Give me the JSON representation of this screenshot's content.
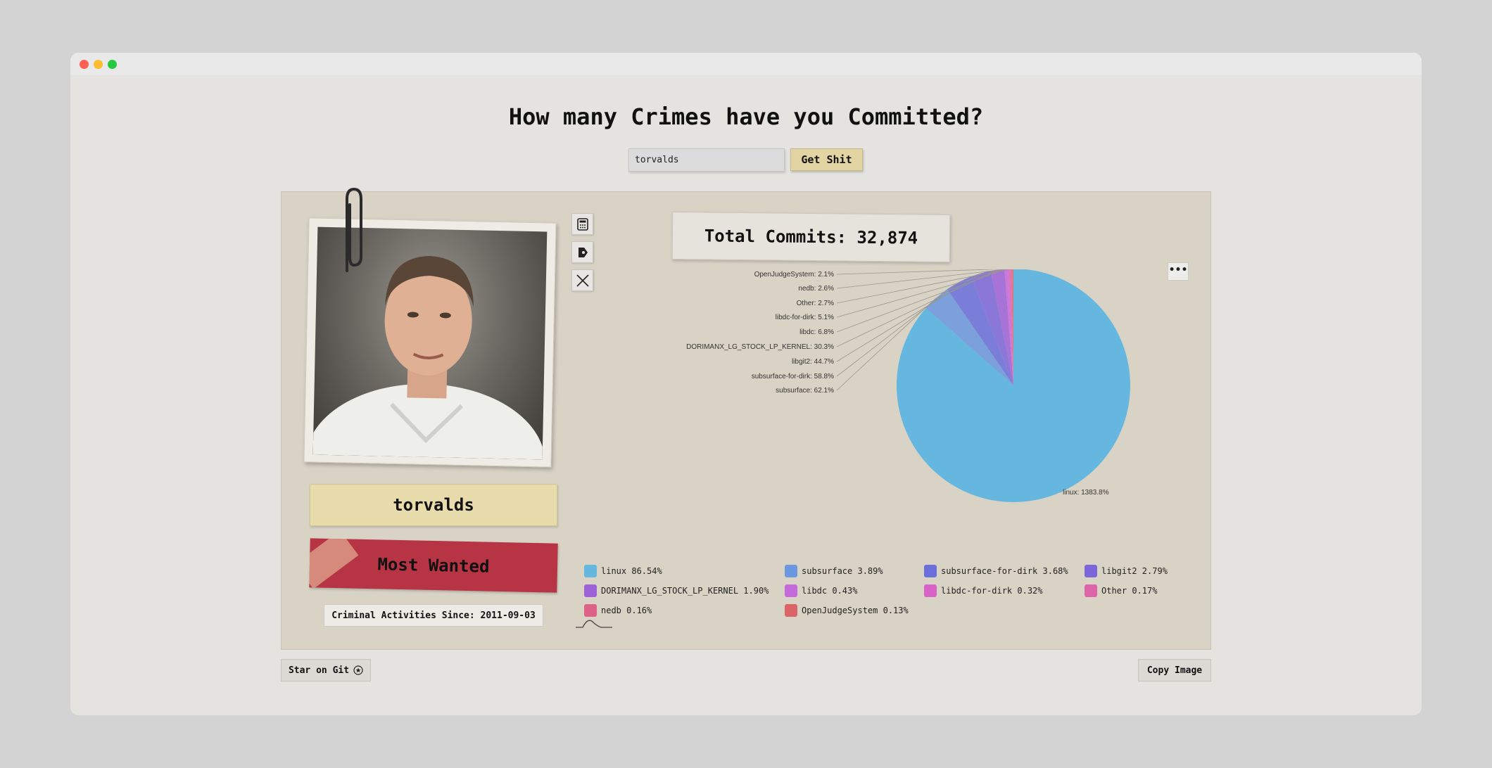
{
  "header": {
    "title": "How many Crimes have you Committed?"
  },
  "search": {
    "value": "torvalds",
    "button_label": "Get Shit"
  },
  "profile": {
    "username": "torvalds",
    "status": "Most Wanted",
    "since": "Criminal Activities Since: 2011-09-03"
  },
  "stats": {
    "total_commits": "Total Commits: 32,874"
  },
  "toolbar": {
    "more_label": "•••"
  },
  "colors": {
    "linux": "#66b7df",
    "subsurface": "#6a97de",
    "subsurface-for-dirk": "#6a6fdc",
    "libgit2": "#7b66d9",
    "DORIMANX_LG_STOCK_LP_KERNEL": "#9d62d8",
    "libdc": "#c669dc",
    "libdc-for-dirk": "#d962c9",
    "Other": "#dd64a8",
    "nedb": "#de6188",
    "OpenJudgeSystem": "#dc6466"
  },
  "chart_data": {
    "type": "pie",
    "slices": [
      {
        "name": "linux",
        "percent": 86.54,
        "label": "linux: 1383.8%"
      },
      {
        "name": "subsurface",
        "percent": 3.89,
        "label": "subsurface: 62.1%"
      },
      {
        "name": "subsurface-for-dirk",
        "percent": 3.68,
        "label": "subsurface-for-dirk: 58.8%"
      },
      {
        "name": "libgit2",
        "percent": 2.79,
        "label": "libgit2: 44.7%"
      },
      {
        "name": "DORIMANX_LG_STOCK_LP_KERNEL",
        "percent": 1.9,
        "label": "DORIMANX_LG_STOCK_LP_KERNEL: 30.3%"
      },
      {
        "name": "libdc",
        "percent": 0.43,
        "label": "libdc: 6.8%"
      },
      {
        "name": "libdc-for-dirk",
        "percent": 0.32,
        "label": "libdc-for-dirk: 5.1%"
      },
      {
        "name": "Other",
        "percent": 0.17,
        "label": "Other: 2.7%"
      },
      {
        "name": "nedb",
        "percent": 0.16,
        "label": "nedb: 2.6%"
      },
      {
        "name": "OpenJudgeSystem",
        "percent": 0.13,
        "label": "OpenJudgeSystem: 2.1%"
      }
    ],
    "legend": [
      "linux 86.54%",
      "subsurface 3.89%",
      "subsurface-for-dirk 3.68%",
      "libgit2 2.79%",
      "DORIMANX_LG_STOCK_LP_KERNEL 1.90%",
      "libdc 0.43%",
      "libdc-for-dirk 0.32%",
      "Other 0.17%",
      "nedb 0.16%",
      "OpenJudgeSystem 0.13%"
    ]
  },
  "footer": {
    "star_label": "Star on Git",
    "copy_label": "Copy Image"
  }
}
